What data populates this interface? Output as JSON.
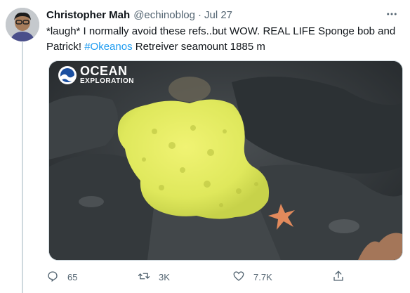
{
  "tweet": {
    "author_name": "Christopher Mah",
    "handle": "@echinoblog",
    "separator": "·",
    "date": "Jul 27",
    "text_part1": "*laugh* I normally avoid these refs..but WOW. REAL LIFE Sponge bob and Patrick! ",
    "hashtag": "#Okeanos",
    "text_part2": " Retreiver seamount  1885 m",
    "media": {
      "watermark_line1": "OCEAN",
      "watermark_line2": "EXPLORATION",
      "watermark_badge": "NOAA",
      "watermark_color": "#ffffff",
      "sponge_color": "#e2ea5d",
      "starfish_color": "#e28a5c"
    },
    "actions": {
      "reply_count": "65",
      "retweet_count": "3K",
      "like_count": "7.7K"
    },
    "colors": {
      "accent": "#1d9bf0",
      "secondary_text": "#536471",
      "thread_line": "#cfd9de"
    },
    "icons": [
      "more-icon",
      "reply-icon",
      "retweet-icon",
      "like-icon",
      "share-icon"
    ]
  }
}
